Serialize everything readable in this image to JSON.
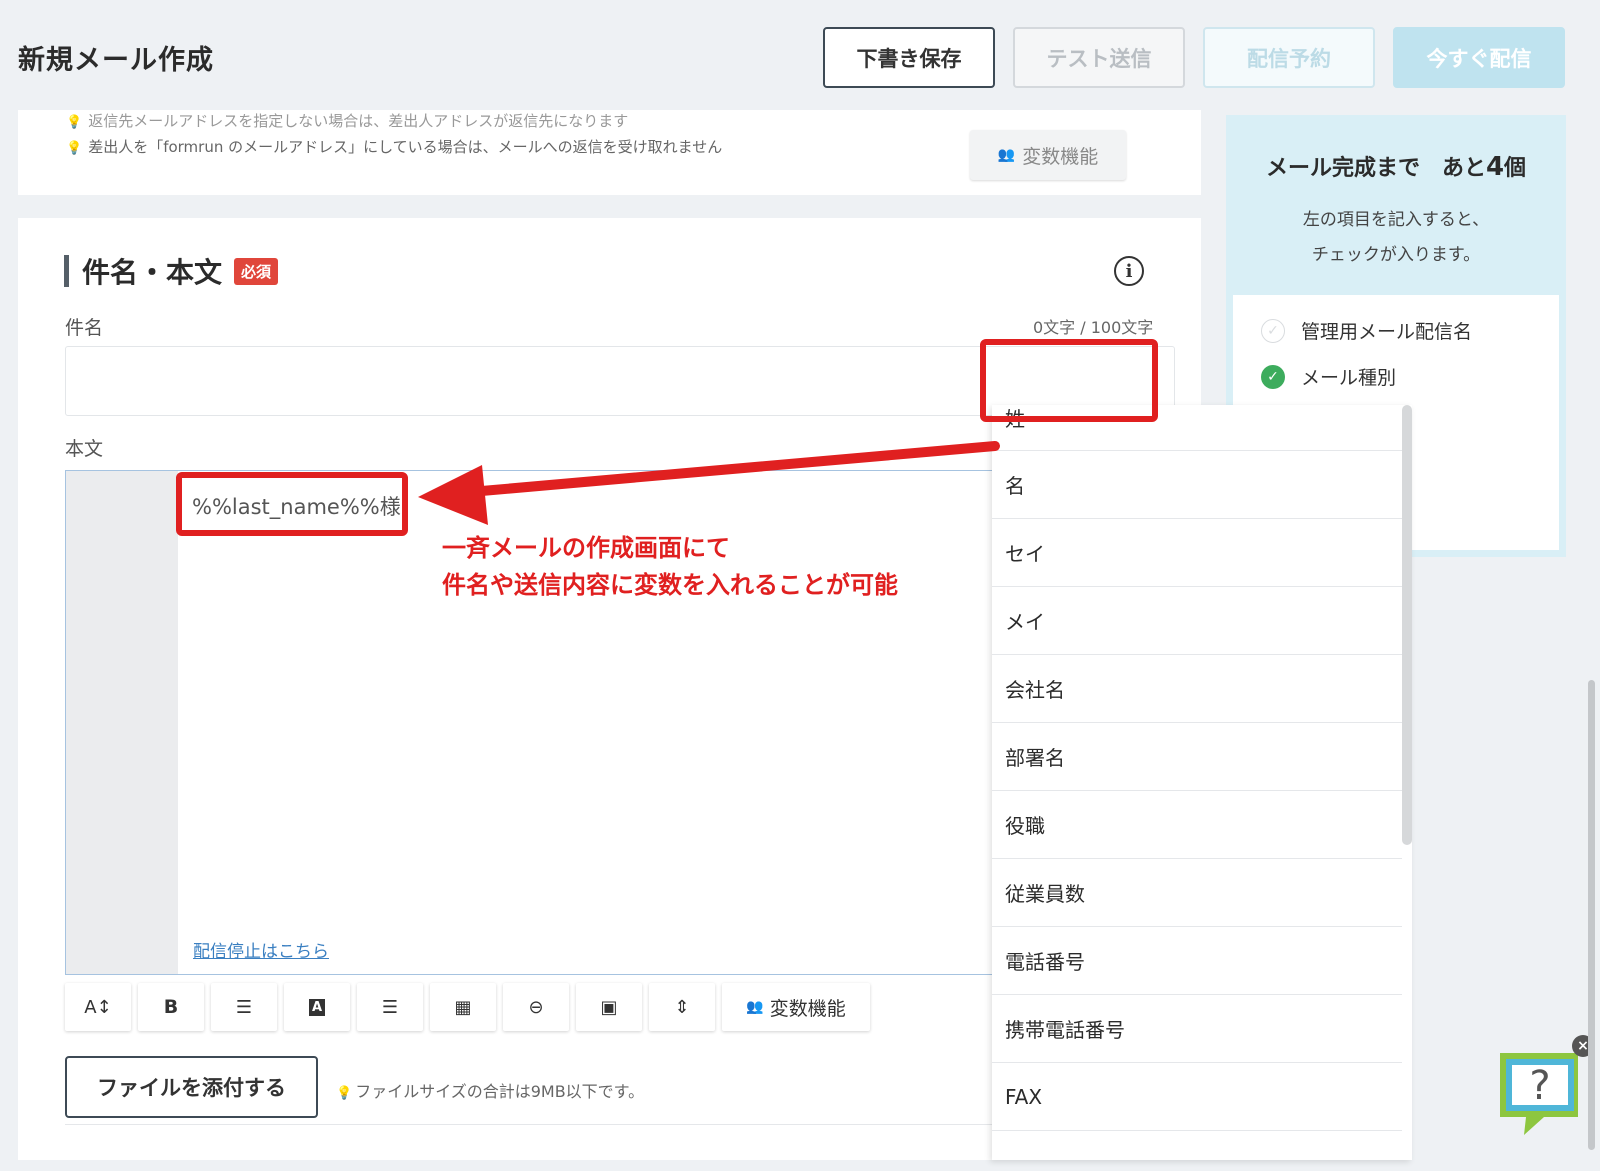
{
  "header": {
    "title": "新規メール作成",
    "buttons": {
      "draft": "下書き保存",
      "test": "テスト送信",
      "reserve": "配信予約",
      "send_now": "今すぐ配信"
    }
  },
  "notes": [
    "返信先メールアドレスを指定しない場合は、差出人アドレスが返信先になります",
    "差出人を「formrun のメールアドレス」にしている場合は、メールへの返信を受け取れません"
  ],
  "section": {
    "title": "件名・本文",
    "required_badge": "必須",
    "info_icon": "i"
  },
  "subject": {
    "label": "件名",
    "char_count": "0文字 / 100文字",
    "value": "",
    "variable_button": "変数機能"
  },
  "body": {
    "label": "本文",
    "value": "%%last_name%%様",
    "unsubscribe_link": "配信停止はこちら"
  },
  "toolbar": {
    "font_size": "A↕",
    "bold": "B",
    "list": "☰",
    "color": "A",
    "align": "☰",
    "table": "▦",
    "link": "⊖",
    "image": "▣",
    "spacing": "⇕",
    "variable": "変数機能"
  },
  "attach": {
    "button": "ファイルを添付する",
    "note": "ファイルサイズの合計は9MB以下です。"
  },
  "progress": {
    "title_prefix": "メール完成まで　あと",
    "count": "4",
    "title_suffix": "個",
    "description": "左の項目を記入すると、\nチェックが入ります。",
    "items": [
      {
        "label": "管理用メール配信名",
        "checked": false
      },
      {
        "label": "メール種別",
        "checked": true
      }
    ]
  },
  "dropdown": {
    "items": [
      "姓",
      "名",
      "セイ",
      "メイ",
      "会社名",
      "部署名",
      "役職",
      "従業員数",
      "電話番号",
      "携帯電話番号",
      "FAX"
    ]
  },
  "annotation": {
    "text": "一斉メールの作成画面にて\n件名や送信内容に変数を入れることが可能",
    "color": "#e02020"
  },
  "help_widget": {
    "symbol": "?",
    "close": "×"
  },
  "colors": {
    "accent_light_blue": "#bfe3ef",
    "panel_blue": "#d9eff6",
    "required_red": "#e0463b",
    "check_green": "#3dac5d",
    "link_blue": "#3a7fc1"
  }
}
